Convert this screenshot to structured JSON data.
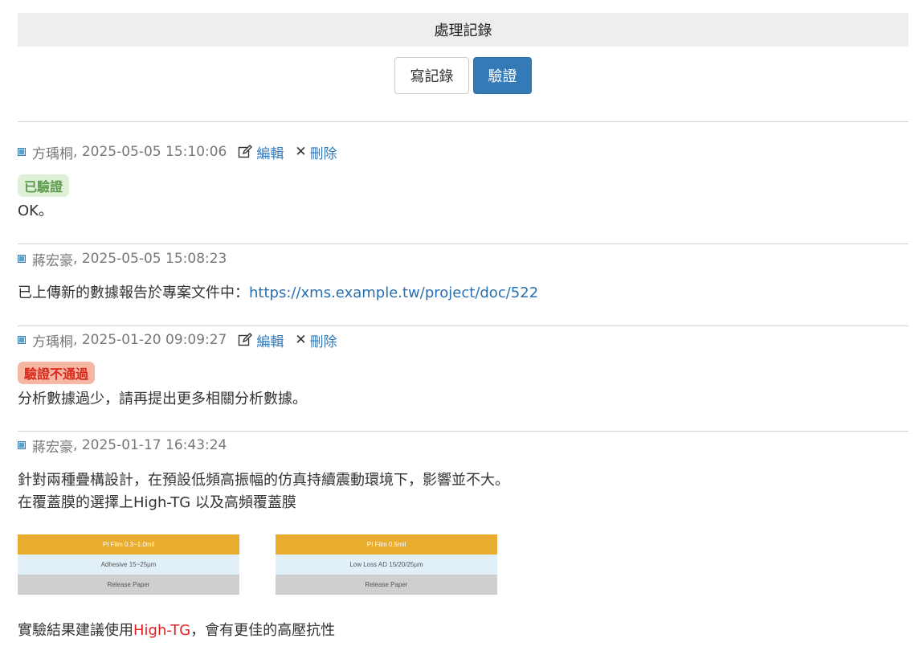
{
  "header": {
    "title": "處理記錄"
  },
  "toolbar": {
    "write_label": "寫記錄",
    "verify_label": "驗證"
  },
  "records": [
    {
      "author": "方瑀桐",
      "timestamp": "2025-05-05 15:10:06",
      "edit_label": "編輯",
      "delete_label": "刪除",
      "badge": "已驗證",
      "body": "OK。"
    },
    {
      "author": "蔣宏豪",
      "timestamp": "2025-05-05 15:08:23",
      "body_prefix": "已上傳新的數據報告於專案文件中：",
      "link": "https://xms.example.tw/project/doc/522"
    },
    {
      "author": "方瑀桐",
      "timestamp": "2025-01-20 09:09:27",
      "edit_label": "編輯",
      "delete_label": "刪除",
      "badge": "驗證不通過",
      "body": "分析數據過少，請再提出更多相關分析數據。"
    },
    {
      "author": "蔣宏豪",
      "timestamp": "2025-01-17 16:43:24",
      "line1": "針對兩種疊構設計，在預設低頻高振幅的仿真持續震動環境下，影響並不大。",
      "line2": "在覆蓋膜的選擇上High-TG 以及高頻覆蓋膜",
      "stack_a": [
        "PI Film 0.3~1.0mil",
        "Adhesive 15~25μm",
        "Release Paper"
      ],
      "stack_b": [
        "PI Film 0.5mil",
        "Low Loss AD 15/20/25μm",
        "Release Paper"
      ],
      "conclusion_prefix": "實驗結果建議使用",
      "conclusion_highlight": "High-TG",
      "conclusion_suffix": "，會有更佳的高壓抗性"
    }
  ],
  "colors": {
    "primary": "#337ab7",
    "verified_bg": "#dff0d8",
    "rejected_bg": "#f5b7a4",
    "highlight": "#e02020"
  }
}
